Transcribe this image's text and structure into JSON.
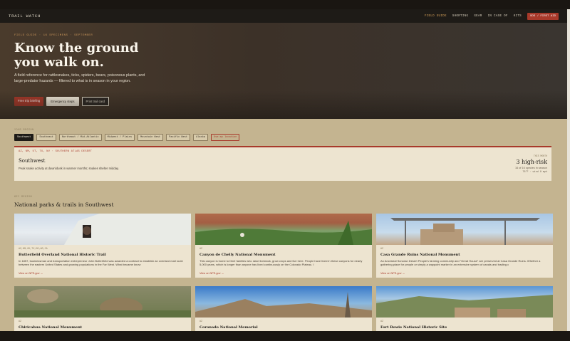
{
  "brand": "TRAIL WATCH",
  "nav": {
    "links": [
      "FIELD GUIDE",
      "SHORTING",
      "GEAR",
      "IN CASE OF",
      "KITS"
    ],
    "cta": "SOS / FIRST AID"
  },
  "hero": {
    "eyebrow": "FIELD GUIDE · 16 SPECIMENS · SEPTEMBER",
    "title": "Know the ground you walk on.",
    "subtitle": "A field reference for rattlesnakes, ticks, spiders, bears, poisonous plants, and large-predator hazards — filtered to what is in season in your region.",
    "buttons": [
      "Free trip briefing",
      "Emergency steps",
      "Print trail card"
    ]
  },
  "region": {
    "label": "YOUR REGION",
    "tabs": [
      "Southwest",
      "Southeast",
      "Northeast / Mid-Atlantic",
      "Midwest / Plains",
      "Mountain West",
      "Pacific West",
      "Alaska",
      "Use my location"
    ],
    "active_tab": "Southwest",
    "codes": "AZ, NM, UT, TX, NV · SOUTHERN ATLAS DESERT",
    "title": "Southwest",
    "description": "Peak snake activity at dawn/dusk in warmer months; snakes shelter midday.",
    "month_label": "THIS MONTH",
    "risk": "3 high-risk",
    "count": "16 of 16 species in season",
    "weather": "76°F · wind 8 mph"
  },
  "parks": {
    "label": "KEY REGION",
    "title": "National parks & trails in Southwest",
    "cards": [
      {
        "meta": "AZ,NM,OK,TX,MO,AR,CA",
        "title": "Butterfield Overland National Historic Trail",
        "desc": "In 1857, businessman and transportation entrepreneur John Butterfield was awarded a contract to establish an overland mail route between the eastern United States and growing populations in the Far West. What became know",
        "link": "View on NPS.gov →"
      },
      {
        "meta": "AZ",
        "title": "Canyon de Chelly National Monument",
        "desc": "This canyon is home to Diné families who raise livestock, grow crops and live here. People have lived in these canyons for nearly 5,000 years, which is longer than anyone has lived continuously on the Colorado Plateau. I",
        "link": "View on NPS.gov →"
      },
      {
        "meta": "AZ",
        "title": "Casa Grande Ruins National Monument",
        "desc": "An Ancestral Sonoran Desert People's farming community and \"Great House\" are preserved at Casa Grande Ruins. Whether a gathering place for people or simply a waypoint marker in an extensive system of canals and trading c",
        "link": "View on NPS.gov →"
      },
      {
        "meta": "AZ",
        "title": "Chiricahua National Monument",
        "desc": "",
        "link": ""
      },
      {
        "meta": "AZ",
        "title": "Coronado National Memorial",
        "desc": "",
        "link": ""
      },
      {
        "meta": "AZ",
        "title": "Fort Bowie National Historic Site",
        "desc": "",
        "link": ""
      }
    ]
  },
  "colors": {
    "accent": "#a8392a",
    "dark": "#1e1b17",
    "sand": "#c4b490",
    "card": "#ede4d0"
  }
}
